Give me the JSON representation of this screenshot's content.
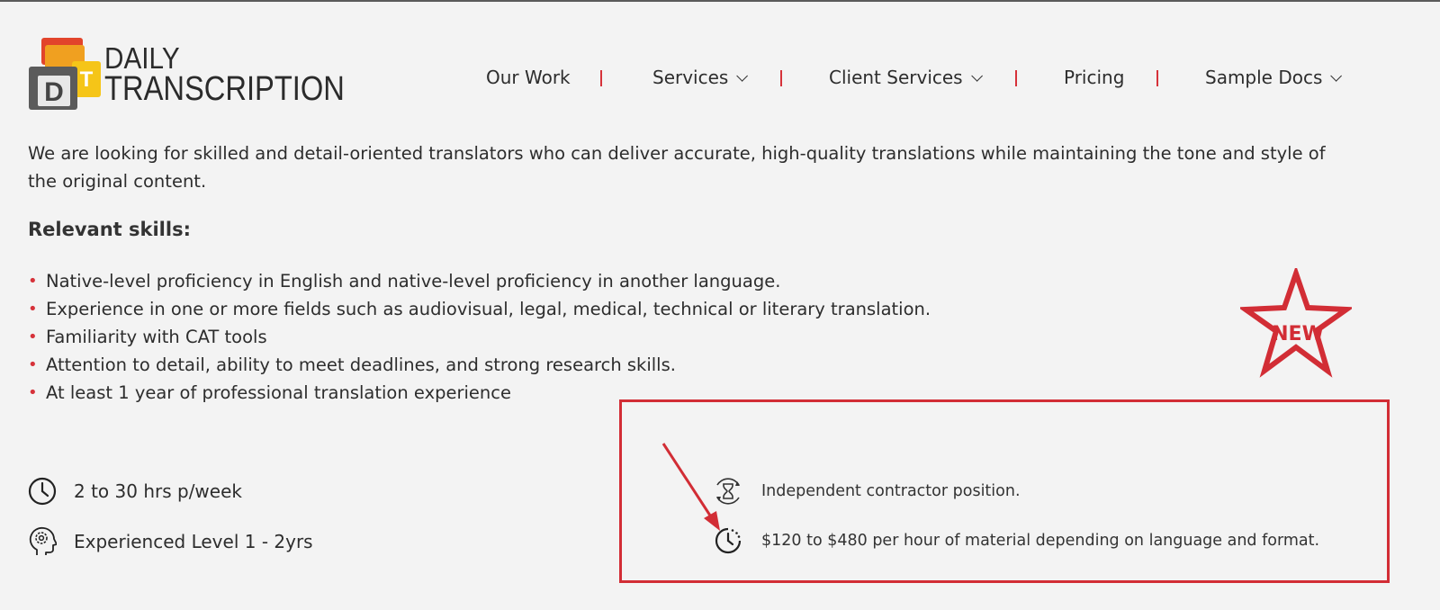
{
  "logo": {
    "line1": "DAILY",
    "line2": "TRANSCRIPTION",
    "mark_letters": [
      "D",
      "T"
    ]
  },
  "nav": {
    "items": [
      {
        "label": "Our Work",
        "has_dropdown": false
      },
      {
        "label": "Services",
        "has_dropdown": true
      },
      {
        "label": "Client Services",
        "has_dropdown": true
      },
      {
        "label": "Pricing",
        "has_dropdown": false
      },
      {
        "label": "Sample Docs",
        "has_dropdown": true
      }
    ]
  },
  "content": {
    "intro": "We are looking for skilled and detail-oriented translators who can deliver accurate, high-quality translations while maintaining the tone and style of the original content.",
    "skills_heading": "Relevant skills:",
    "skills": [
      "Native-level proficiency in English and native-level proficiency in another language.",
      "Experience in one or more fields such as audiovisual, legal, medical, technical or literary translation.",
      "Familiarity with CAT tools",
      "Attention to detail, ability to meet deadlines, and strong research skills.",
      "At least 1 year of professional translation experience"
    ]
  },
  "features": {
    "hours": {
      "text": "2 to 30 hrs p/week",
      "icon": "clock-icon"
    },
    "level": {
      "text": "Experienced Level 1 - 2yrs",
      "icon": "head-gear-icon"
    },
    "position": {
      "text": "Independent contractor position.",
      "icon": "hourglass-icon"
    },
    "pay": {
      "text": "$120 to $480 per hour of material depending on language and format.",
      "icon": "timer-icon"
    }
  },
  "annotations": {
    "new_badge": "NEW"
  },
  "colors": {
    "accent_red": "#d22d35",
    "background": "#f3f3f3",
    "text": "#2d2d2d"
  }
}
